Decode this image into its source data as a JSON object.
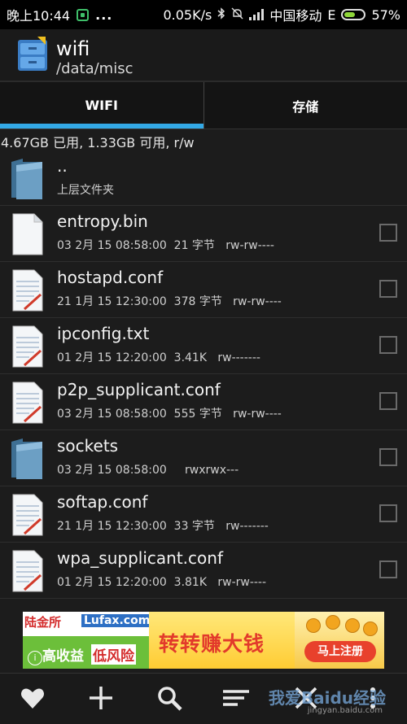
{
  "status_bar": {
    "time": "晚上10:44",
    "dots": "...",
    "speed": "0.05K/s",
    "carrier": "中国移动",
    "network": "E",
    "battery": "57%",
    "battery_level": 0.57,
    "icons": [
      "shield-app-icon",
      "bluetooth-icon",
      "mute-bell-icon",
      "signal-icon",
      "battery-icon"
    ]
  },
  "action_bar": {
    "title": "wifi",
    "path": "/data/misc",
    "app_icon": "file-cabinet-icon"
  },
  "tabs": [
    {
      "label": "WIFI",
      "active": true
    },
    {
      "label": "存储",
      "active": false
    }
  ],
  "storage_info": "4.67GB 已用, 1.33GB 可用, r/w",
  "files": [
    {
      "name": "..",
      "meta": "上层文件夹",
      "icon": "folder-icon",
      "checkbox": false
    },
    {
      "name": "entropy.bin",
      "meta": "03 2月 15 08:58:00  21 字节   rw-rw----",
      "icon": "blank-file-icon",
      "checkbox": true
    },
    {
      "name": "hostapd.conf",
      "meta": "21 1月 15 12:30:00  378 字节   rw-rw----",
      "icon": "text-file-icon",
      "checkbox": true
    },
    {
      "name": "ipconfig.txt",
      "meta": "01 2月 15 12:20:00  3.41K   rw-------",
      "icon": "text-file-icon",
      "checkbox": true
    },
    {
      "name": "p2p_supplicant.conf",
      "meta": "03 2月 15 08:58:00  555 字节   rw-rw----",
      "icon": "text-file-icon",
      "checkbox": true
    },
    {
      "name": "sockets",
      "meta": "03 2月 15 08:58:00     rwxrwx---",
      "icon": "folder-icon",
      "checkbox": true
    },
    {
      "name": "softap.conf",
      "meta": "21 1月 15 12:30:00  33 字节   rw-------",
      "icon": "text-file-icon",
      "checkbox": true
    },
    {
      "name": "wpa_supplicant.conf",
      "meta": "01 2月 15 12:20:00  3.81K   rw-rw----",
      "icon": "text-file-icon",
      "checkbox": true
    }
  ],
  "ad": {
    "brand_cn": "陆金所",
    "brand_en": "Lufax.com",
    "tagline_1": "高收益",
    "tagline_2": "低风险",
    "headline": "转转赚大钱",
    "button": "马上注册",
    "info": "i"
  },
  "bottom_bar": {
    "buttons": [
      "favorite-heart-icon",
      "add-plus-icon",
      "search-icon",
      "sort-lines-icon",
      "close-x-icon",
      "overflow-icon"
    ]
  },
  "watermark": {
    "text": "我爱Baidu经验",
    "url": "jingyan.baidu.com"
  }
}
